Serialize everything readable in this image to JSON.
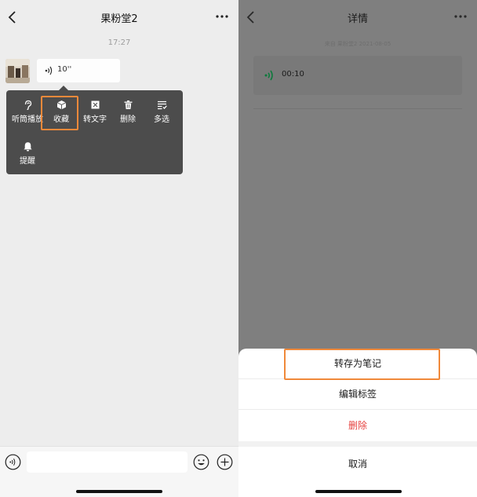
{
  "colors": {
    "highlight": "#f0893a",
    "delete_red": "#e64340",
    "voice_green": "#07c160"
  },
  "chat": {
    "title": "果粉堂2",
    "timestamp": "17:27",
    "voice_message": {
      "duration": "10''"
    },
    "context_menu": {
      "items": [
        {
          "label": "听筒播放",
          "icon": "ear-icon"
        },
        {
          "label": "收藏",
          "icon": "cube-icon"
        },
        {
          "label": "转文字",
          "icon": "text-convert-icon"
        },
        {
          "label": "删除",
          "icon": "trash-icon"
        },
        {
          "label": "多选",
          "icon": "multi-select-icon"
        },
        {
          "label": "提醒",
          "icon": "bell-icon"
        }
      ]
    }
  },
  "detail": {
    "title": "详情",
    "source": "来自 果粉堂2  2021-08-05",
    "voice_duration": "00:10",
    "sheet": {
      "options": [
        "转存为笔记",
        "编辑标签",
        "删除"
      ],
      "cancel": "取消"
    }
  }
}
